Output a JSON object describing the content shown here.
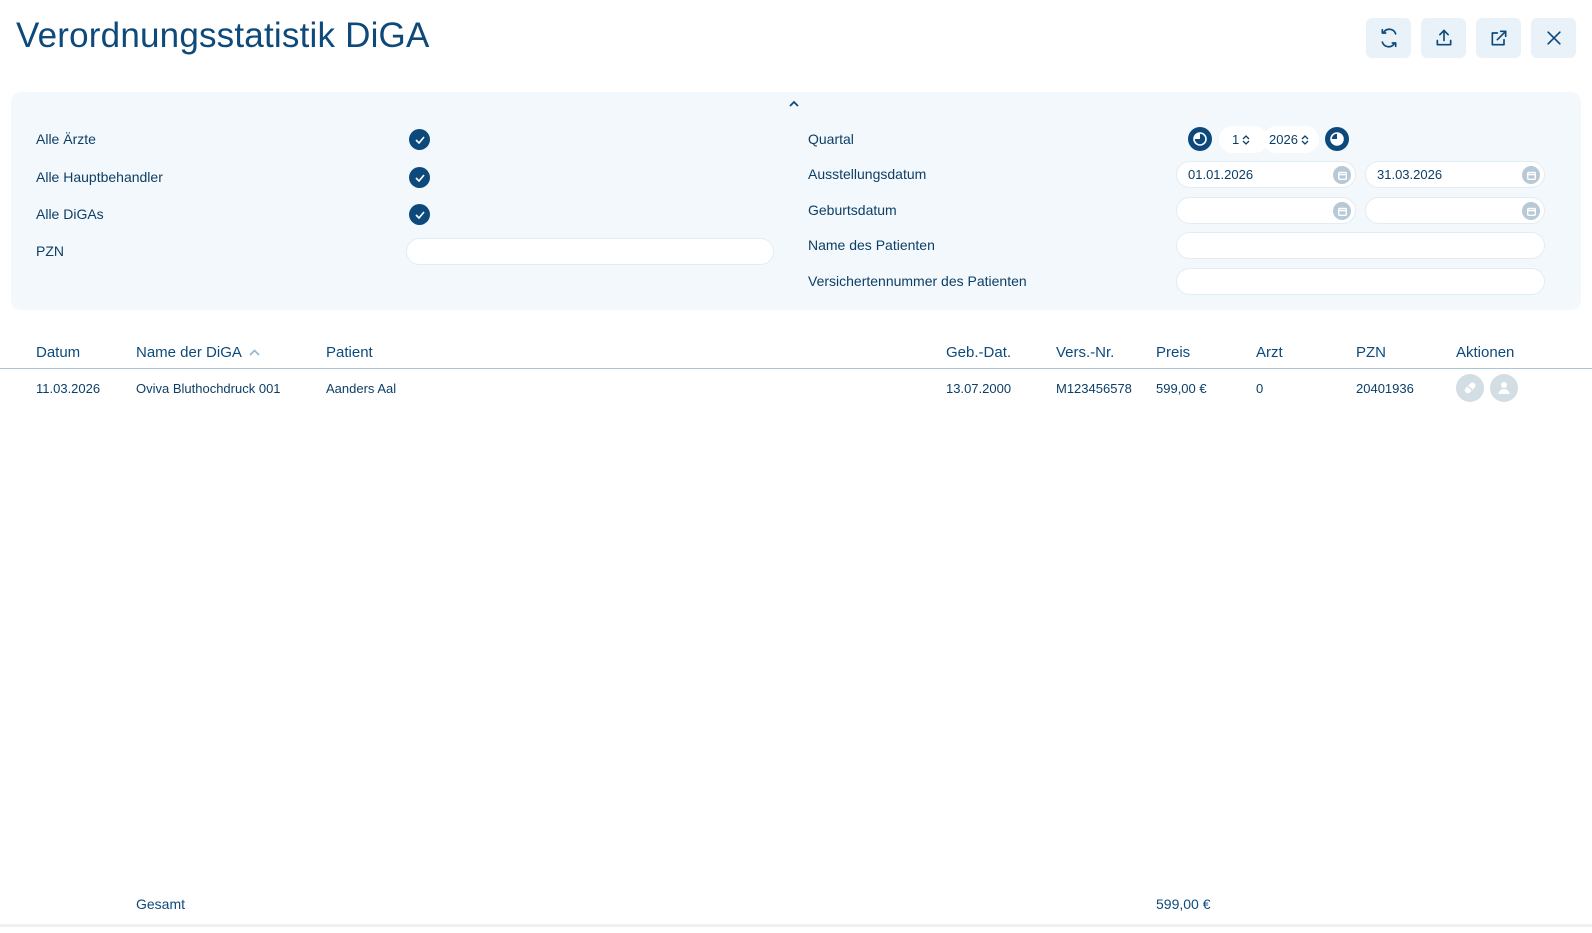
{
  "title": "Verordnungsstatistik DiGA",
  "toolbar": {
    "icons": [
      "refresh-icon",
      "upload-icon",
      "external-link-icon",
      "close-icon"
    ]
  },
  "filters": {
    "left": {
      "all_doctors": "Alle Ärzte",
      "all_main_practitioners": "Alle Hauptbehandler",
      "all_digas": "Alle DiGAs",
      "pzn": "PZN",
      "pzn_value": ""
    },
    "right": {
      "quarter": "Quartal",
      "quarter_value": "1",
      "year_value": "2026",
      "issue_date": "Ausstellungsdatum",
      "issue_from": "01.01.2026",
      "issue_to": "31.03.2026",
      "birth_date": "Geburtsdatum",
      "birth_from": "",
      "birth_to": "",
      "patient_name": "Name des Patienten",
      "patient_name_value": "",
      "insurance_number": "Versichertennummer des Patienten",
      "insurance_number_value": ""
    },
    "checkboxes": {
      "all_doctors": true,
      "all_main_practitioners": true,
      "all_digas": true
    }
  },
  "table": {
    "headers": {
      "date": "Datum",
      "diga_name": "Name der DiGA",
      "patient": "Patient",
      "birth_date": "Geb.-Dat.",
      "insurance_no": "Vers.-Nr.",
      "price": "Preis",
      "doctor": "Arzt",
      "pzn": "PZN",
      "actions": "Aktionen"
    },
    "sort": {
      "column": "diga_name",
      "direction": "ascending"
    },
    "rows": [
      {
        "date": "11.03.2026",
        "diga_name": "Oviva Bluthochdruck 001",
        "patient": "Aanders Aal",
        "birth_date": "13.07.2000",
        "insurance_no": "M123456578",
        "price": "599,00 €",
        "doctor": "0",
        "pzn": "20401936",
        "actions": [
          "pill-icon",
          "person-icon"
        ]
      }
    ]
  },
  "footer": {
    "total_label": "Gesamt",
    "total_value": "599,00 €"
  },
  "colors": {
    "primary": "#0d4a7b",
    "panel_bg": "#f3f8fc",
    "button_bg": "#e9f2f8",
    "muted_icon": "#d3dde4"
  }
}
